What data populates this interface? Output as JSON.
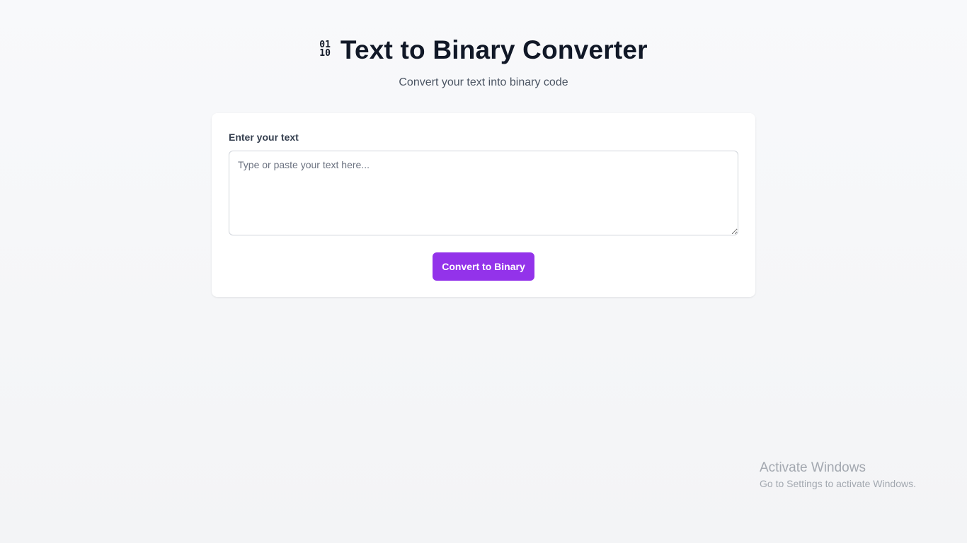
{
  "header": {
    "icon_top": "01",
    "icon_bottom": "10",
    "icon_name": "binary-icon",
    "title": "Text to Binary Converter",
    "subtitle": "Convert your text into binary code"
  },
  "form": {
    "label": "Enter your text",
    "input_value": "",
    "placeholder": "Type or paste your text here...",
    "button_label": "Convert to Binary"
  },
  "watermark": {
    "title": "Activate Windows",
    "subtitle": "Go to Settings to activate Windows."
  },
  "colors": {
    "accent": "#9333ea",
    "text": "#111827",
    "muted": "#4b5563",
    "background": "#f3f4f6"
  }
}
